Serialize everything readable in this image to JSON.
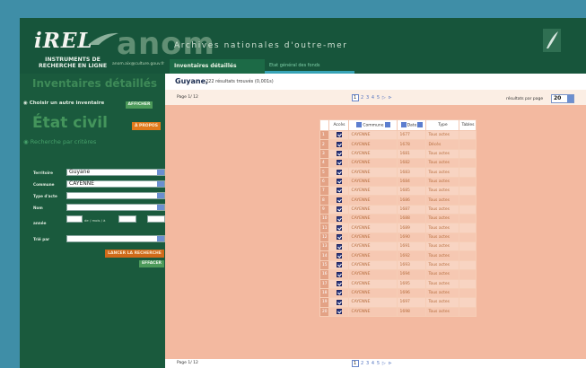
{
  "header": {
    "logo": "iREL",
    "brand": "anom",
    "subtitle": "INSTRUMENTS DE RECHERCHE EN LIGNE",
    "email": "anom.aix@culture.gouv.fr",
    "archives_title": "Archives nationales d'outre-mer",
    "tab_active": "Inventaires détaillés",
    "tab_sub": "Etat général des fonds"
  },
  "sidebar": {
    "inventaires_heading": "Inventaires détaillés",
    "choose_label": "Choisir un autre inventaire",
    "afficher_button": "AFFICHER",
    "etat_civil_heading": "État civil",
    "apropos_button": "À PROPOS",
    "recherche_label": "Recherche par critères",
    "fields": {
      "territoire_label": "Territoire",
      "territoire_value": "Guyane",
      "commune_label": "Commune",
      "commune_value": "CAYENNE",
      "type_acte_label": "Type d'acte",
      "type_acte_value": "",
      "nom_label": "Nom",
      "nom_value": "",
      "annee_label": "année",
      "annee_from_label": "de / mois / à",
      "tri_label": "Trié par",
      "tri_value": ""
    },
    "lancer_button": "LANCER LA RECHERCHE",
    "effacer_button": "EFFACER"
  },
  "main": {
    "result_title": "Guyane,",
    "result_count": "222 résultats trouvés (0,001s)",
    "page_label_top": "Page 1/ 12",
    "page_label_bottom": "Page 1/ 12",
    "pager_current": "1",
    "pager_pages": "2 3 4 5",
    "pager_arrows": "▷ ⊳",
    "per_page_label": "résultats par page",
    "per_page_value": "20"
  },
  "table": {
    "headers": {
      "acces": "Accès",
      "commune": "Commune",
      "date": "Date",
      "type": "Type",
      "tables": "Tables"
    },
    "rows": [
      {
        "num": "1",
        "commune": "CAYENNE",
        "date": "1677",
        "type": "Tous actes"
      },
      {
        "num": "2",
        "commune": "CAYENNE",
        "date": "1678",
        "type": "Décès"
      },
      {
        "num": "3",
        "commune": "CAYENNE",
        "date": "1681",
        "type": "Tous actes"
      },
      {
        "num": "4",
        "commune": "CAYENNE",
        "date": "1682",
        "type": "Tous actes"
      },
      {
        "num": "5",
        "commune": "CAYENNE",
        "date": "1683",
        "type": "Tous actes"
      },
      {
        "num": "6",
        "commune": "CAYENNE",
        "date": "1684",
        "type": "Tous actes"
      },
      {
        "num": "7",
        "commune": "CAYENNE",
        "date": "1685",
        "type": "Tous actes"
      },
      {
        "num": "8",
        "commune": "CAYENNE",
        "date": "1686",
        "type": "Tous actes"
      },
      {
        "num": "9",
        "commune": "CAYENNE",
        "date": "1687",
        "type": "Tous actes"
      },
      {
        "num": "10",
        "commune": "CAYENNE",
        "date": "1688",
        "type": "Tous actes"
      },
      {
        "num": "11",
        "commune": "CAYENNE",
        "date": "1689",
        "type": "Tous actes"
      },
      {
        "num": "12",
        "commune": "CAYENNE",
        "date": "1690",
        "type": "Tous actes"
      },
      {
        "num": "13",
        "commune": "CAYENNE",
        "date": "1691",
        "type": "Tous actes"
      },
      {
        "num": "14",
        "commune": "CAYENNE",
        "date": "1692",
        "type": "Tous actes"
      },
      {
        "num": "15",
        "commune": "CAYENNE",
        "date": "1693",
        "type": "Tous actes"
      },
      {
        "num": "16",
        "commune": "CAYENNE",
        "date": "1694",
        "type": "Tous actes"
      },
      {
        "num": "17",
        "commune": "CAYENNE",
        "date": "1695",
        "type": "Tous actes"
      },
      {
        "num": "18",
        "commune": "CAYENNE",
        "date": "1696",
        "type": "Tous actes"
      },
      {
        "num": "19",
        "commune": "CAYENNE",
        "date": "1697",
        "type": "Tous actes"
      },
      {
        "num": "20",
        "commune": "CAYENNE",
        "date": "1698",
        "type": "Tous actes"
      }
    ]
  }
}
